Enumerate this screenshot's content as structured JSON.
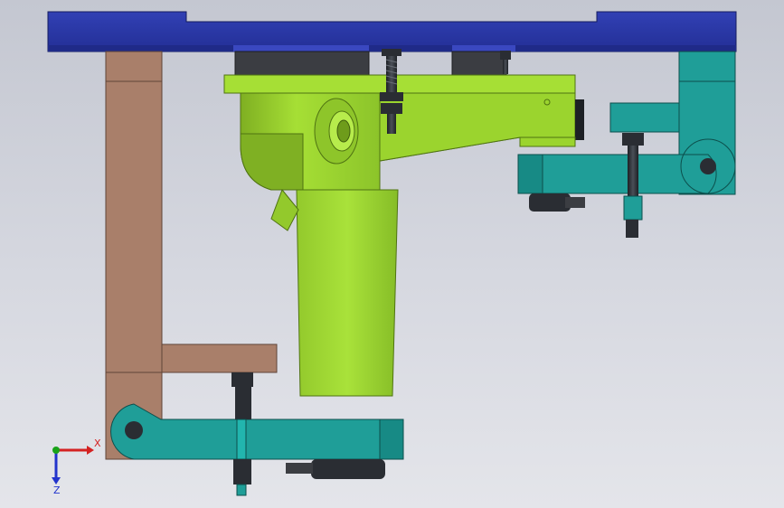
{
  "viewport": {
    "background_top": "#c4c7d1",
    "background_bottom": "#e4e5ea"
  },
  "colors": {
    "top_plate": "#2b38a8",
    "column": "#a97f6a",
    "housing": "#9bd42e",
    "housing_shadow": "#6f9c1c",
    "clamp_arm": "#1f9e98",
    "clamp_arm_dark": "#137a76",
    "fastener": "#2a2d33",
    "axis_x": "#d42222",
    "axis_y": "#19a319",
    "axis_z": "#2233cc"
  },
  "triad": {
    "x_label": "X",
    "z_label": "Z",
    "icon": "coordinate-triad-icon"
  }
}
